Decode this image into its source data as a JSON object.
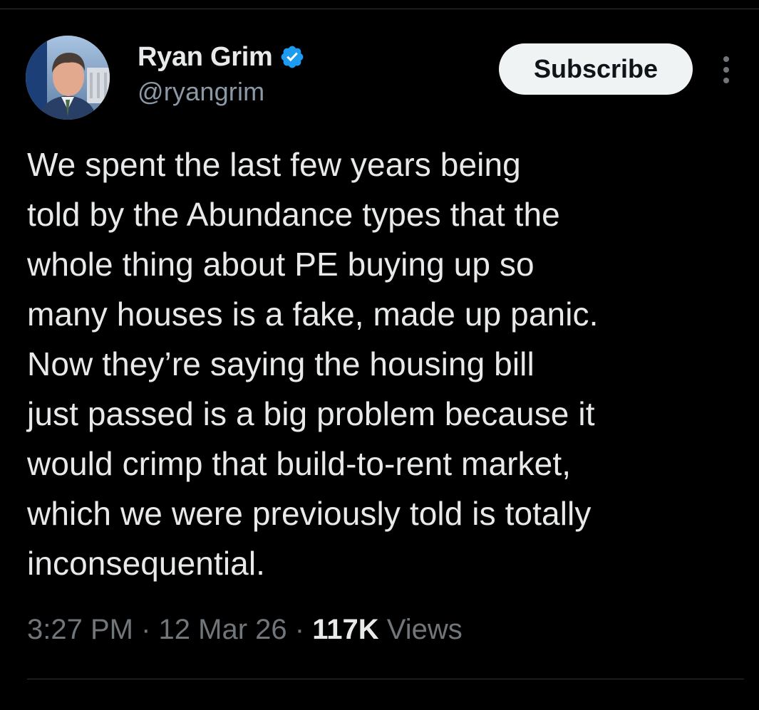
{
  "author": {
    "name": "Ryan Grim",
    "handle": "@ryangrim",
    "verified": true
  },
  "actions": {
    "subscribe_label": "Subscribe"
  },
  "tweet": {
    "text": "We spent the last few years being\ntold by the Abundance types that the\nwhole thing about PE buying up so\nmany houses is a fake, made up panic.\nNow they’re saying the housing bill\njust passed is a big problem because it\nwould crimp that build-to-rent market,\nwhich we were previously told is totally\ninconsequential."
  },
  "meta": {
    "time": "3:27 PM",
    "separator": "·",
    "date": "12 Mar 26",
    "views_count": "117K",
    "views_label": "Views"
  },
  "colors": {
    "background": "#000000",
    "text": "#e7e9ea",
    "secondary_text": "#71767b",
    "verified_badge": "#1d9bf0",
    "subscribe_bg": "#eff3f4"
  }
}
